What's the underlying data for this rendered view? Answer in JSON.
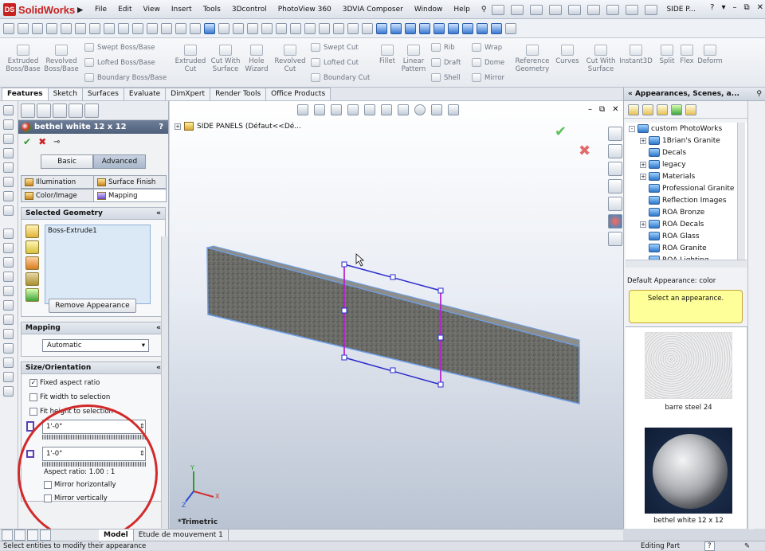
{
  "app": {
    "brand": "SolidWorks",
    "title_fragment": "SIDE P..."
  },
  "menu": [
    "File",
    "Edit",
    "View",
    "Insert",
    "Tools",
    "3Dcontrol",
    "PhotoView 360",
    "3DVIA Composer",
    "Window",
    "Help"
  ],
  "commands": {
    "extruded_boss": "Extruded Boss/Base",
    "revolved_boss": "Revolved Boss/Base",
    "swept_boss": "Swept Boss/Base",
    "lofted_boss": "Lofted Boss/Base",
    "boundary_boss": "Boundary Boss/Base",
    "extruded_cut": "Extruded Cut",
    "cut_with_surface": "Cut With Surface",
    "hole_wizard": "Hole Wizard",
    "revolved_cut": "Revolved Cut",
    "swept_cut": "Swept Cut",
    "lofted_cut": "Lofted Cut",
    "boundary_cut": "Boundary Cut",
    "fillet": "Fillet",
    "linear_pattern": "Linear Pattern",
    "rib": "Rib",
    "draft": "Draft",
    "shell": "Shell",
    "wrap": "Wrap",
    "dome": "Dome",
    "mirror": "Mirror",
    "reference_geometry": "Reference Geometry",
    "curves": "Curves",
    "cut_with_surface2": "Cut With Surface",
    "instant3d": "Instant3D",
    "split": "Split",
    "flex": "Flex",
    "deform": "Deform"
  },
  "tabs": [
    "Features",
    "Sketch",
    "Surfaces",
    "Evaluate",
    "DimXpert",
    "Render Tools",
    "Office Products"
  ],
  "pm": {
    "title": "bethel white 12 x 12",
    "help": "?",
    "basic": "Basic",
    "advanced": "Advanced",
    "illumination": "Illumination",
    "surface_finish": "Surface Finish",
    "color_image": "Color/Image",
    "mapping_tab": "Mapping",
    "selected_geometry": "Selected Geometry",
    "selected_item": "Boss-Extrude1",
    "remove_appearance": "Remove Appearance",
    "mapping_group": "Mapping",
    "mapping_value": "Automatic",
    "size_orientation": "Size/Orientation",
    "fixed_aspect": "Fixed aspect ratio",
    "fit_width": "Fit width to selection",
    "fit_height": "Fit height to selection",
    "width_value": "1'-0\"",
    "height_value": "1'-0\"",
    "aspect_ratio": "Aspect ratio: 1.00 : 1",
    "mirror_h": "Mirror horizontally",
    "mirror_v": "Mirror vertically"
  },
  "viewport": {
    "doc_title": "SIDE PANELS  (Défaut<<Dé...",
    "view_label": "*Trimetric"
  },
  "right_panel": {
    "title": "Appearances, Scenes, a...",
    "tree": [
      {
        "label": "custom PhotoWorks",
        "level": 0,
        "expander": "-"
      },
      {
        "label": "1Brian's Granite",
        "level": 1,
        "expander": "+"
      },
      {
        "label": "Decals",
        "level": 1,
        "expander": ""
      },
      {
        "label": "legacy",
        "level": 1,
        "expander": "+"
      },
      {
        "label": "Materials",
        "level": 1,
        "expander": "+"
      },
      {
        "label": "Professional Granite",
        "level": 1,
        "expander": ""
      },
      {
        "label": "Reflection Images",
        "level": 1,
        "expander": ""
      },
      {
        "label": "ROA Bronze",
        "level": 1,
        "expander": ""
      },
      {
        "label": "ROA Decals",
        "level": 1,
        "expander": "+"
      },
      {
        "label": "ROA Glass",
        "level": 1,
        "expander": ""
      },
      {
        "label": "ROA Granite",
        "level": 1,
        "expander": ""
      },
      {
        "label": "ROA Lighting",
        "level": 1,
        "expander": ""
      }
    ],
    "default_appearance": "Default Appearance: color",
    "hint": "Select an appearance.",
    "thumb1": "barre steel 24",
    "thumb2": "bethel white 12 x 12"
  },
  "bottom_tabs": [
    "Model",
    "Etude de mouvement 1"
  ],
  "status": {
    "left": "Select entities to modify their appearance",
    "right": "Editing Part",
    "help": "?"
  }
}
